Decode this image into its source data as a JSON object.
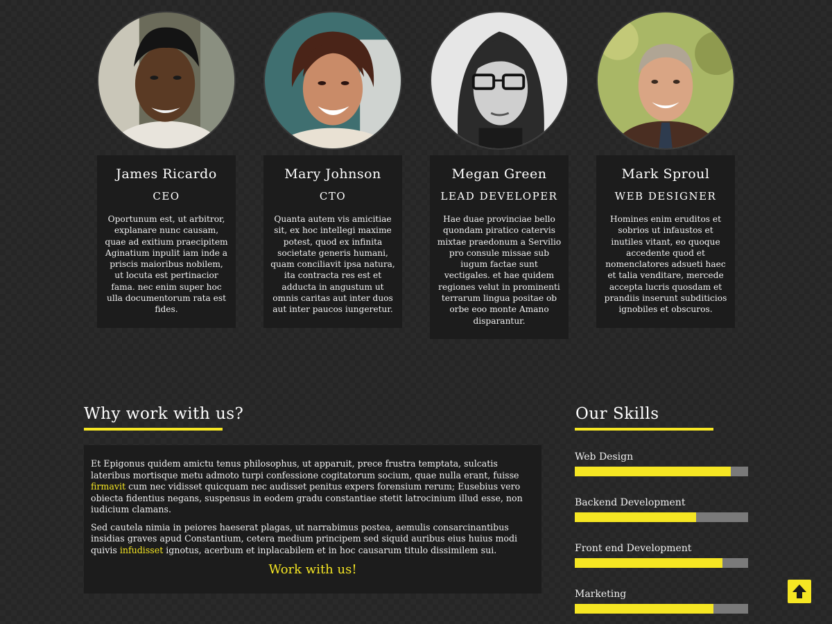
{
  "team": [
    {
      "name": "James Ricardo",
      "role": "CEO",
      "bio": "Oportunum est, ut arbitror, explanare nunc causam, quae ad exitium praecipitem Aginatium inpulit iam inde a priscis maioribus nobilem, ut locuta est pertinacior fama. nec enim super hoc ulla documentorum rata est fides.",
      "avatar_icon": "portrait-photo"
    },
    {
      "name": "Mary Johnson",
      "role": "CTO",
      "bio": "Quanta autem vis amicitiae sit, ex hoc intellegi maxime potest, quod ex infinita societate generis humani, quam conciliavit ipsa natura, ita contracta res est et adducta in angustum ut omnis caritas aut inter duos aut inter paucos iungeretur.",
      "avatar_icon": "portrait-photo"
    },
    {
      "name": "Megan Green",
      "role": "LEAD DEVELOPER",
      "bio": "Hae duae provinciae bello quondam piratico catervis mixtae praedonum a Servilio pro consule missae sub iugum factae sunt vectigales. et hae quidem regiones velut in prominenti terrarum lingua positae ob orbe eoo monte Amano disparantur.",
      "avatar_icon": "portrait-photo"
    },
    {
      "name": "Mark Sproul",
      "role": "WEB DESIGNER",
      "bio": "Homines enim eruditos et sobrios ut infaustos et inutiles vitant, eo quoque accedente quod et nomenclatores adsueti haec et talia venditare, mercede accepta lucris quosdam et prandiis inserunt subditicios ignobiles et obscuros.",
      "avatar_icon": "portrait-photo"
    }
  ],
  "why": {
    "title": "Why work with us?",
    "p1_a": "Et Epigonus quidem amictu tenus philosophus, ut apparuit, prece frustra temptata, sulcatis lateribus mortisque metu admoto turpi confessione cogitatorum socium, quae nulla erant, fuisse ",
    "p1_link": "firmavit",
    "p1_b": " cum nec vidisset quicquam nec audisset penitus expers forensium rerum; Eusebius vero obiecta fidentius negans, suspensus in eodem gradu constantiae stetit latrocinium illud esse, non iudicium clamans.",
    "p2_a": "Sed cautela nimia in peiores haeserat plagas, ut narrabimus postea, aemulis consarcinantibus insidias graves apud Constantium, cetera medium principem sed siquid auribus eius huius modi quivis ",
    "p2_link": "infudisset",
    "p2_b": " ignotus, acerbum et inplacabilem et in hoc causarum titulo dissimilem sui.",
    "cta": "Work with us!"
  },
  "skills": {
    "title": "Our Skills",
    "items": [
      {
        "label": "Web Design",
        "percent": 90
      },
      {
        "label": "Backend Development",
        "percent": 70
      },
      {
        "label": "Front end Development",
        "percent": 85
      },
      {
        "label": "Marketing",
        "percent": 80
      }
    ]
  },
  "colors": {
    "accent": "#f5e623",
    "card_bg": "#1c1c1c",
    "bar_track": "#7a7a7a"
  },
  "back_to_top_icon": "arrow-up-icon"
}
